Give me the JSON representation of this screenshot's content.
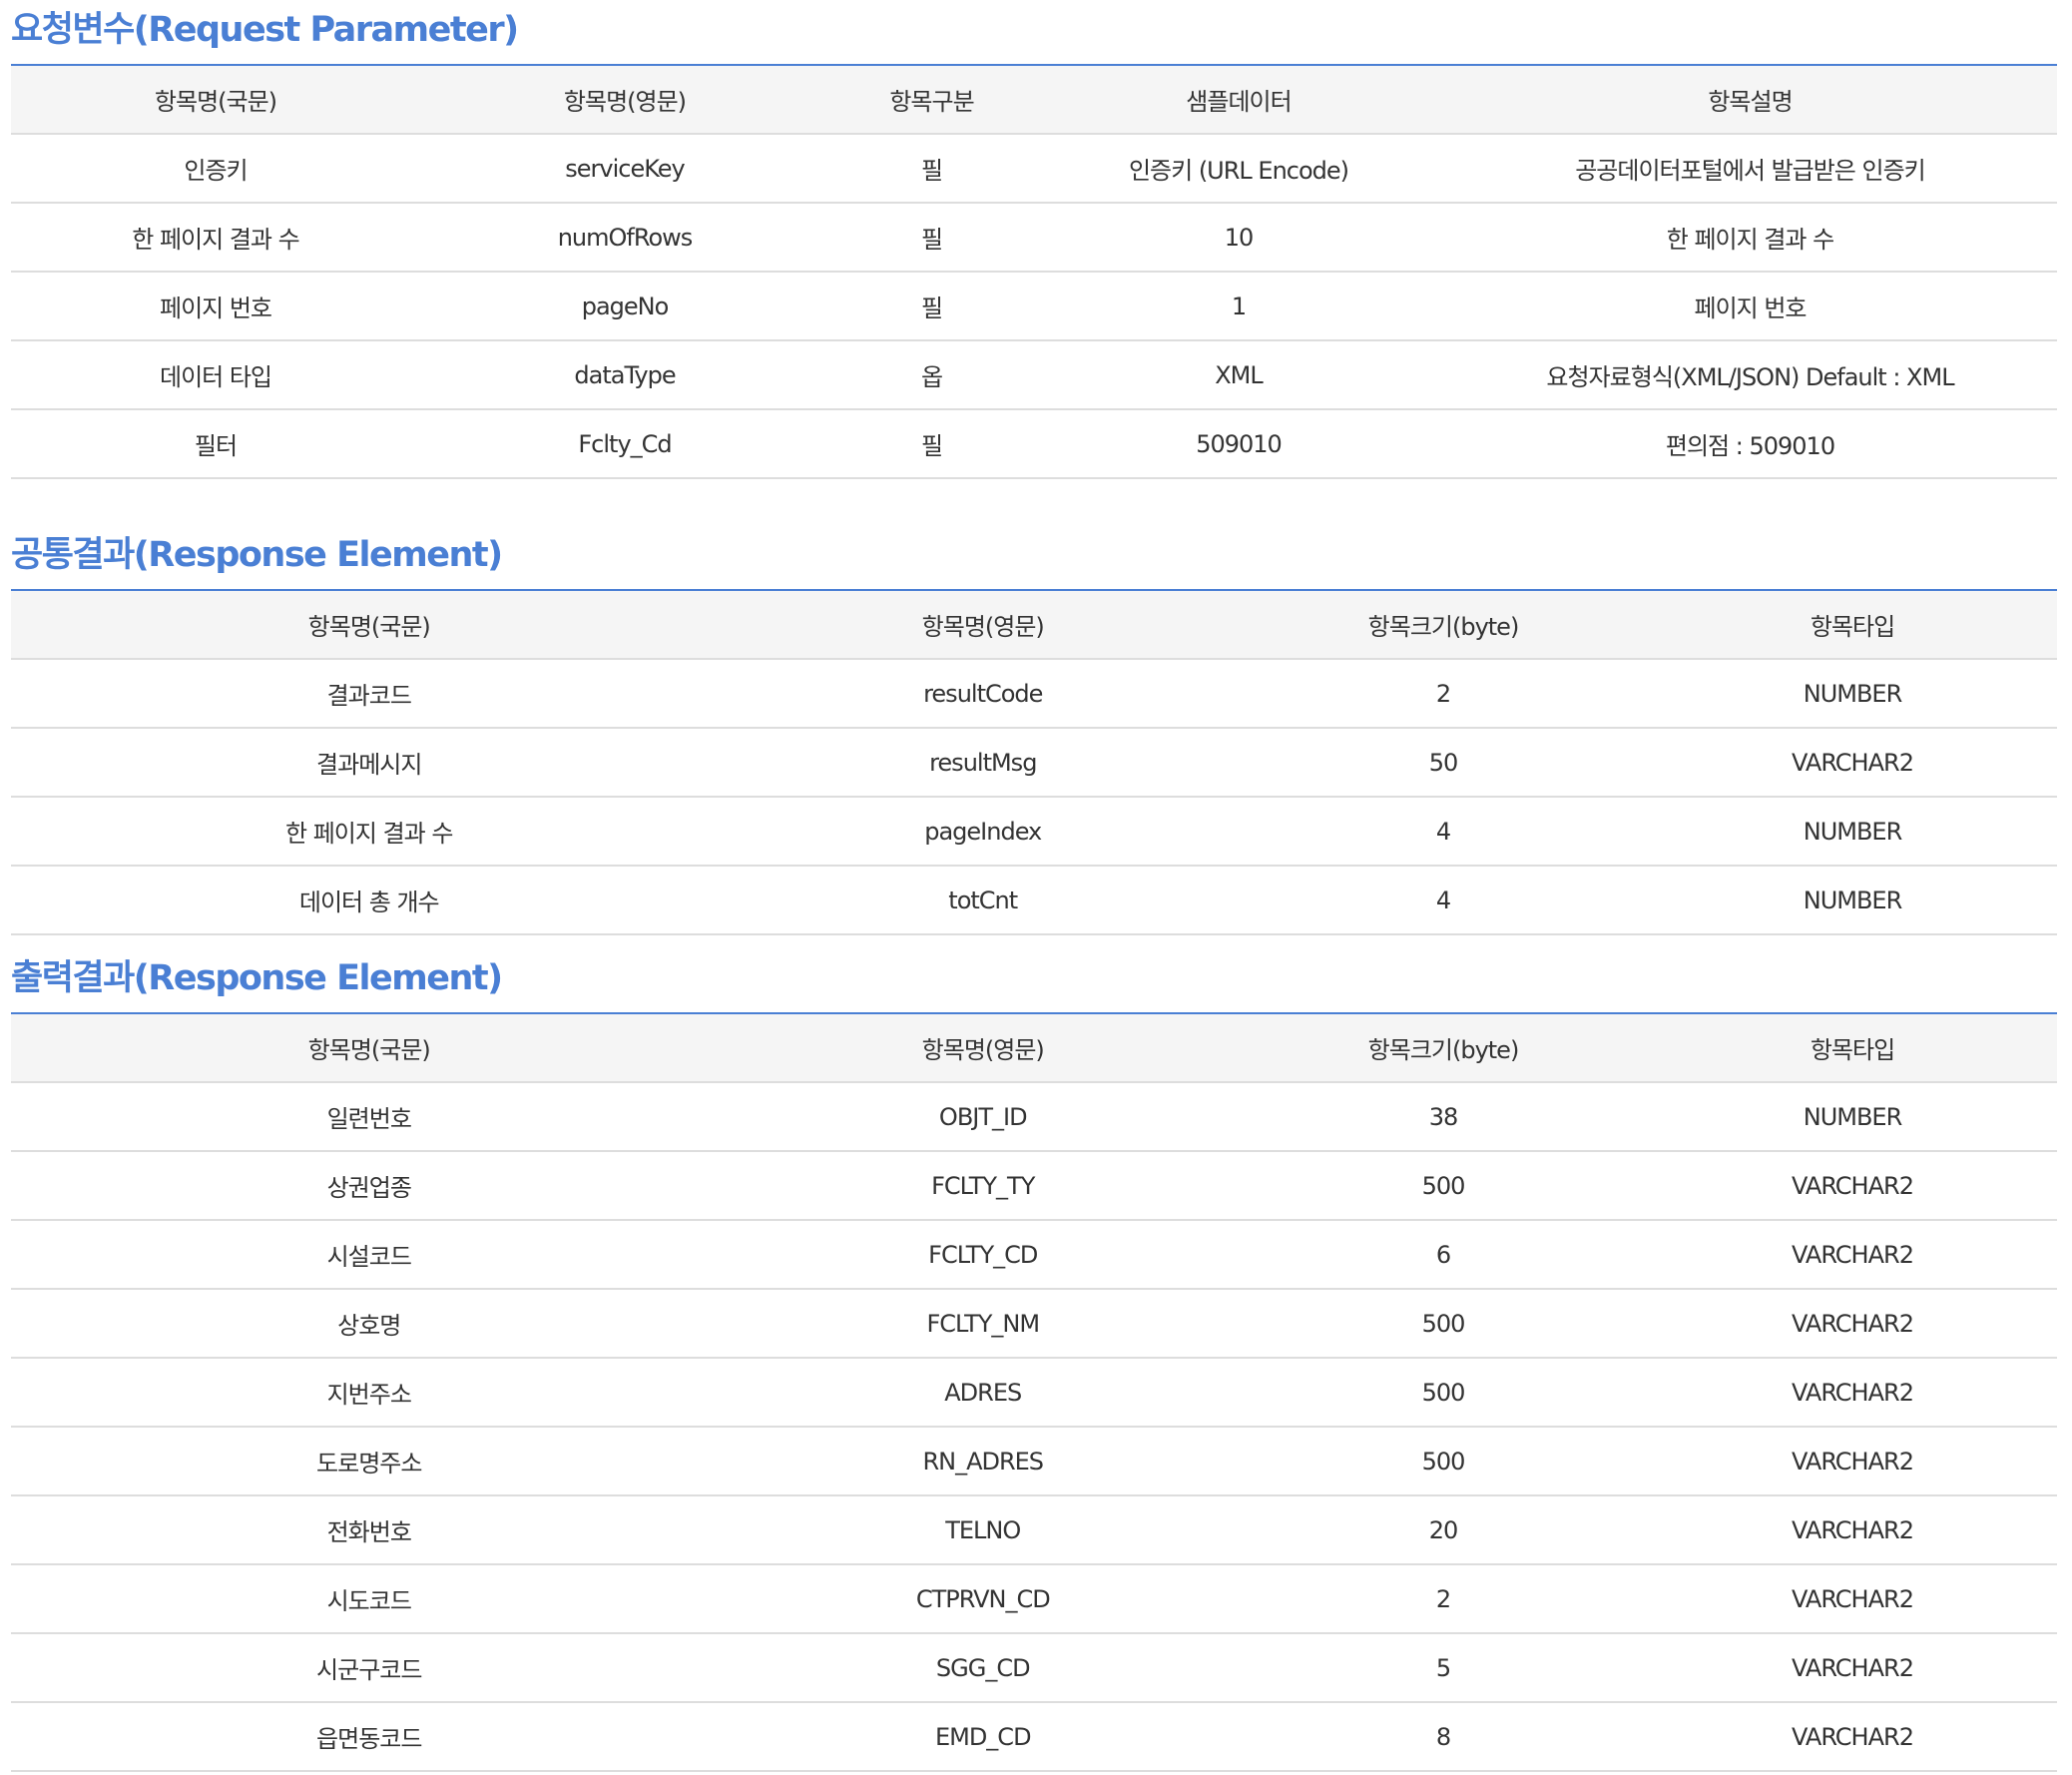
{
  "request": {
    "title": "요청변수(Request Parameter)",
    "headers": [
      "항목명(국문)",
      "항목명(영문)",
      "항목구분",
      "샘플데이터",
      "항목설명"
    ],
    "rows": [
      [
        "인증키",
        "serviceKey",
        "필",
        "인증키 (URL Encode)",
        "공공데이터포털에서 발급받은 인증키"
      ],
      [
        "한 페이지 결과 수",
        "numOfRows",
        "필",
        "10",
        "한 페이지 결과 수"
      ],
      [
        "페이지 번호",
        "pageNo",
        "필",
        "1",
        "페이지 번호"
      ],
      [
        "데이터 타입",
        "dataType",
        "옵",
        "XML",
        "요청자료형식(XML/JSON) Default : XML"
      ],
      [
        "필터",
        "Fclty_Cd",
        "필",
        "509010",
        "편의점 : 509010"
      ]
    ]
  },
  "common": {
    "title": "공통결과(Response Element)",
    "headers": [
      "항목명(국문)",
      "항목명(영문)",
      "항목크기(byte)",
      "항목타입"
    ],
    "rows": [
      [
        "결과코드",
        "resultCode",
        "2",
        "NUMBER"
      ],
      [
        "결과메시지",
        "resultMsg",
        "50",
        "VARCHAR2"
      ],
      [
        "한 페이지 결과 수",
        "pageIndex",
        "4",
        "NUMBER"
      ],
      [
        "데이터 총 개수",
        "totCnt",
        "4",
        "NUMBER"
      ]
    ]
  },
  "output": {
    "title": "출력결과(Response Element)",
    "headers": [
      "항목명(국문)",
      "항목명(영문)",
      "항목크기(byte)",
      "항목타입"
    ],
    "rows": [
      [
        "일련번호",
        "OBJT_ID",
        "38",
        "NUMBER"
      ],
      [
        "상권업종",
        "FCLTY_TY",
        "500",
        "VARCHAR2"
      ],
      [
        "시설코드",
        "FCLTY_CD",
        "6",
        "VARCHAR2"
      ],
      [
        "상호명",
        "FCLTY_NM",
        "500",
        "VARCHAR2"
      ],
      [
        "지번주소",
        "ADRES",
        "500",
        "VARCHAR2"
      ],
      [
        "도로명주소",
        "RN_ADRES",
        "500",
        "VARCHAR2"
      ],
      [
        "전화번호",
        "TELNO",
        "20",
        "VARCHAR2"
      ],
      [
        "시도코드",
        "CTPRVN_CD",
        "2",
        "VARCHAR2"
      ],
      [
        "시군구코드",
        "SGG_CD",
        "5",
        "VARCHAR2"
      ],
      [
        "읍면동코드",
        "EMD_CD",
        "8",
        "VARCHAR2"
      ]
    ]
  }
}
